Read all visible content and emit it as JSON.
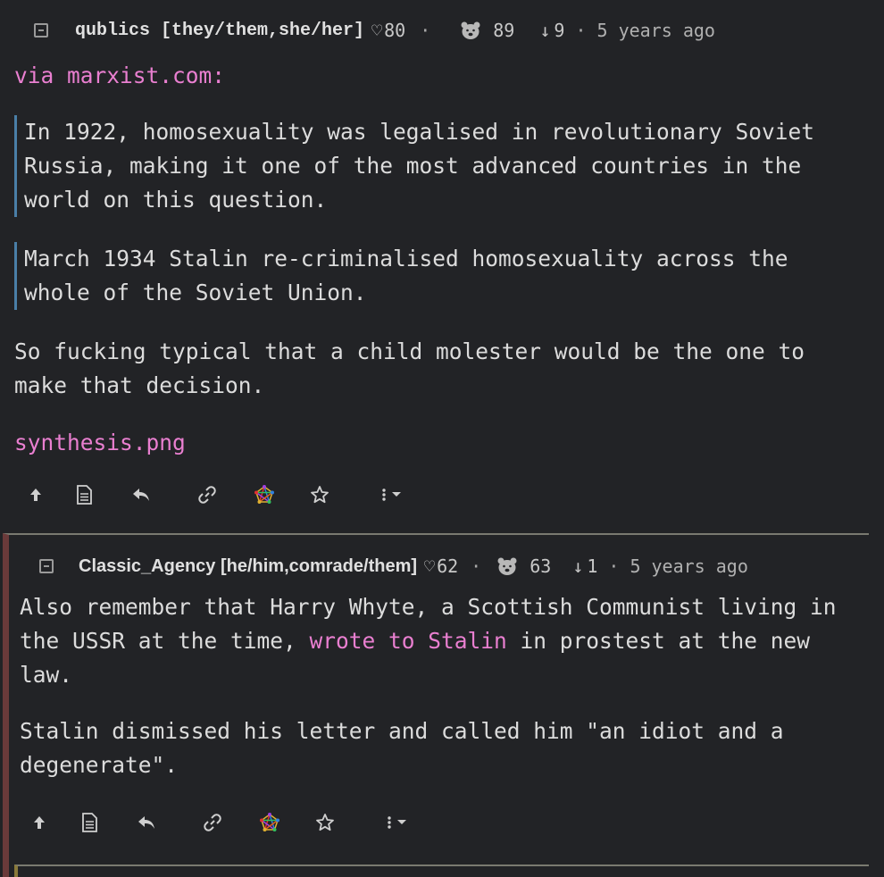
{
  "comments": [
    {
      "username": "qublics [they/them,she/her]",
      "heart_score": "80",
      "bear_score": "89",
      "downvotes": "9",
      "time": "5 years ago",
      "intro_prefix": "via ",
      "intro_link": "marxist.com:",
      "quote1": "In 1922, homosexuality was legalised in revolutionary Soviet Russia, making it one of the most advanced countries in the world on this question.",
      "quote2": "March 1934 Stalin re-criminalised homosexuality across the whole of the Soviet Union.",
      "paragraph": "So fucking typical that a child molester would be the one to make that decision.",
      "image_link": "synthesis.png"
    },
    {
      "username": "Classic_Agency [he/him,comrade/them]",
      "heart_score": "62",
      "bear_score": "63",
      "downvotes": "1",
      "time": "5 years ago",
      "p1_before": "Also remember that Harry Whyte, a Scottish Communist living in the USSR at the time, ",
      "p1_link": "wrote to Stalin",
      "p1_after": " in prostest at the new law.",
      "p2": "Stalin dismissed his letter and called him \"an idiot and a degenerate\"."
    }
  ],
  "symbols": {
    "heart": "♡",
    "separator": "·",
    "down_arrow": "↓"
  },
  "icons": [
    "upvote-arrow-icon",
    "source-document-icon",
    "reply-icon",
    "link-icon",
    "fediverse-icon",
    "star-icon",
    "more-menu-icon"
  ],
  "colors": {
    "background": "#222326",
    "text": "#dcdcdc",
    "link": "#e97fd0",
    "quote_border": "#4a7fa7",
    "thread_border_1": "#6a3a3a",
    "thread_border_2": "#8a7a3a"
  }
}
